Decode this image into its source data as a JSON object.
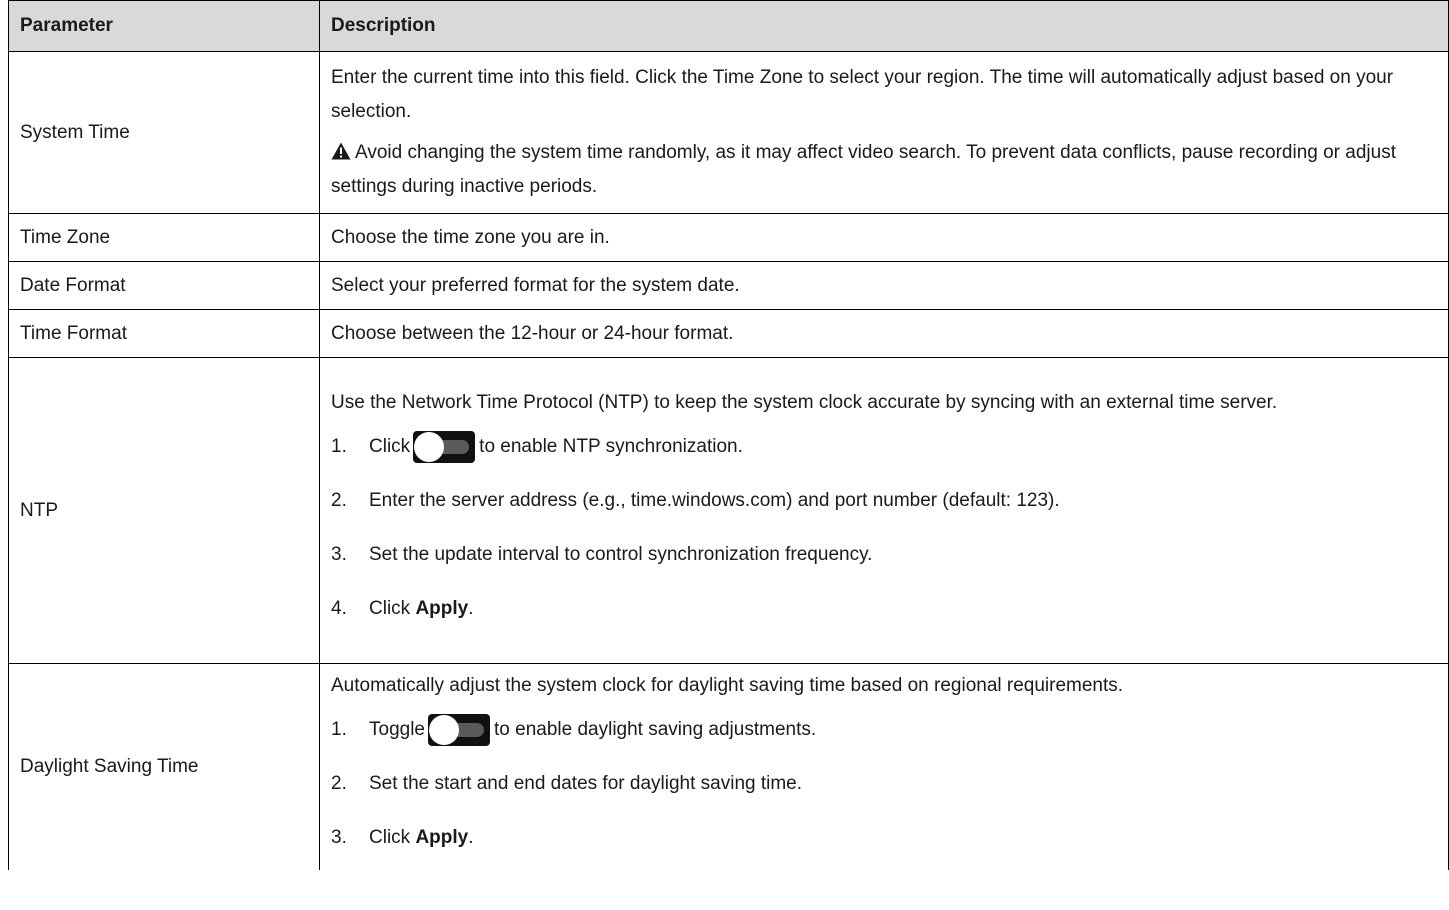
{
  "table": {
    "headers": {
      "parameter": "Parameter",
      "description": "Description"
    },
    "system_time": {
      "name": "System Time",
      "text": "Enter the current time into this field. Click the Time Zone to select your region. The time will automatically adjust based on your selection.",
      "warning": "Avoid changing the system time randomly, as it may affect video search. To prevent data conflicts, pause recording or adjust settings during inactive periods.",
      "warning_icon": "warning-triangle-icon"
    },
    "time_zone": {
      "name": "Time Zone",
      "text": "Choose the time zone you are in."
    },
    "date_format": {
      "name": "Date Format",
      "text": "Select your preferred format for the system date."
    },
    "time_format": {
      "name": "Time Format",
      "text": "Choose between the 12-hour or 24-hour format."
    },
    "ntp": {
      "name": "NTP",
      "text": "Use the Network Time Protocol (NTP) to keep the system clock accurate by syncing with an external time server.",
      "steps": {
        "s1": {
          "num": "1.",
          "before": "Click",
          "after": "to enable NTP synchronization.",
          "icon": "toggle-switch-icon"
        },
        "s2": {
          "num": "2.",
          "text": "Enter the server address (e.g., time.windows.com) and port number (default: 123)."
        },
        "s3": {
          "num": "3.",
          "text": "Set the update interval to control synchronization frequency."
        },
        "s4": {
          "num": "4.",
          "before": "Click ",
          "bold": "Apply",
          "after": "."
        }
      }
    },
    "dst": {
      "name": "Daylight Saving Time",
      "text": "Automatically adjust the system clock for daylight saving time based on regional requirements.",
      "steps": {
        "s1": {
          "num": "1.",
          "before": "Toggle",
          "after": "to enable daylight saving adjustments.",
          "icon": "toggle-switch-icon"
        },
        "s2": {
          "num": "2.",
          "text": "Set the start and end dates for daylight saving time."
        },
        "s3": {
          "num": "3.",
          "before": "Click ",
          "bold": "Apply",
          "after": "."
        }
      }
    }
  }
}
